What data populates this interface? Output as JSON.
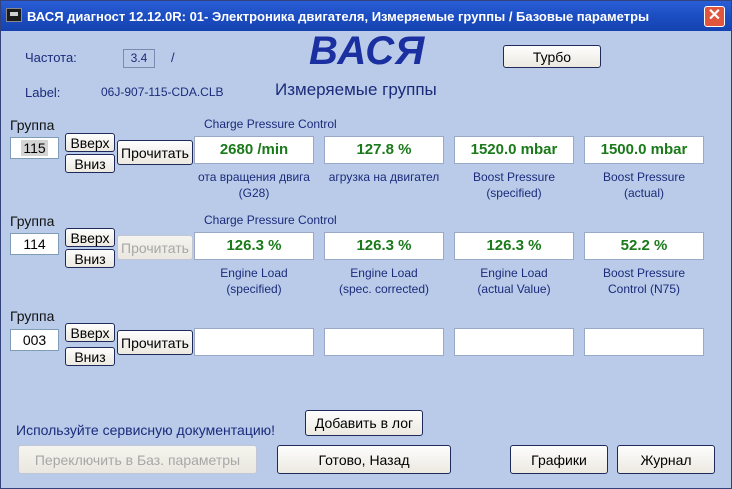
{
  "window": {
    "title": "ВАСЯ диагност 12.12.0R: 01- Электроника двигателя,  Измеряемые группы / Базовые параметры",
    "close_glyph": "✕"
  },
  "header": {
    "freq_label": "Частота:",
    "freq_value": "3.4",
    "freq_sep": "/",
    "brand": "ВАСЯ",
    "turbo_button": "Турбо",
    "label_key": "Label:",
    "label_value": "06J-907-115-CDA.CLB",
    "section_title": "Измеряемые группы"
  },
  "groups": [
    {
      "label": "Группа",
      "number": "115",
      "up": "Вверх",
      "down": "Вниз",
      "read": "Прочитать",
      "title": "Charge Pressure Control",
      "values": [
        "2680 /min",
        "127.8 %",
        "1520.0 mbar",
        "1500.0 mbar"
      ],
      "captions": [
        "ота вращения двига\n(G28)",
        "агрузка на двигател",
        "Boost Pressure\n(specified)",
        "Boost Pressure\n(actual)"
      ]
    },
    {
      "label": "Группа",
      "number": "114",
      "up": "Вверх",
      "down": "Вниз",
      "read": "Прочитать",
      "title": "Charge Pressure Control",
      "values": [
        "126.3 %",
        "126.3 %",
        "126.3 %",
        "52.2 %"
      ],
      "captions": [
        "Engine Load\n(specified)",
        "Engine Load\n(spec. corrected)",
        "Engine Load\n(actual Value)",
        "Boost Pressure\nControl (N75)"
      ]
    },
    {
      "label": "Группа",
      "number": "003",
      "up": "Вверх",
      "down": "Вниз",
      "read": "Прочитать",
      "title": "",
      "values": [
        "",
        "",
        "",
        ""
      ],
      "captions": [
        "",
        "",
        "",
        ""
      ]
    }
  ],
  "footer": {
    "hint": "Используйте сервисную документацию!",
    "add_log": "Добавить в лог",
    "switch_basic": "Переключить в Баз. параметры",
    "done_back": "Готово, Назад",
    "graphs": "Графики",
    "journal": "Журнал"
  }
}
